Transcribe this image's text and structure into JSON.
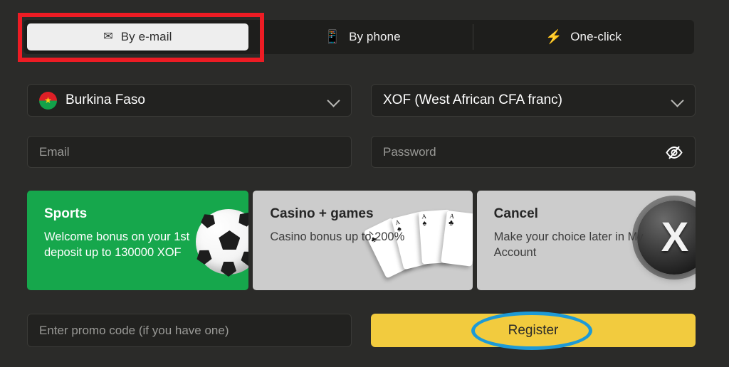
{
  "tabs": [
    {
      "label": "By e-mail",
      "icon": "envelope-icon",
      "glyph": "✉",
      "active": true
    },
    {
      "label": "By phone",
      "icon": "mobile-phone-icon",
      "glyph": "📱",
      "active": false
    },
    {
      "label": "One-click",
      "icon": "lightning-bolt-icon",
      "glyph": "⚡",
      "active": false
    }
  ],
  "form": {
    "country": {
      "value": "Burkina Faso",
      "flag": "burkina-faso-flag",
      "star": "★"
    },
    "currency": {
      "value": "XOF (West African CFA franc)"
    },
    "email": {
      "placeholder": "Email",
      "value": ""
    },
    "password": {
      "placeholder": "Password",
      "value": "",
      "toggle_icon": "eye-slash-icon"
    },
    "promo": {
      "placeholder": "Enter promo code (if you have one)",
      "value": ""
    },
    "register_label": "Register"
  },
  "bonus_cards": [
    {
      "title": "Sports",
      "description": "Welcome bonus on your 1st deposit up to 130000 XOF",
      "art": "soccer-ball-icon",
      "color": "#16a74c"
    },
    {
      "title": "Casino + games",
      "description": "Casino bonus up to 200%",
      "art": "playing-cards-icon",
      "color": "#cccccc"
    },
    {
      "title": "Cancel",
      "description": "Make your choice later in My Account",
      "art": "x-button-icon",
      "color": "#cccccc"
    }
  ],
  "annotations": {
    "tab_highlight_color": "#ed1c24",
    "register_highlight_color": "#1d9ad6"
  },
  "theme": {
    "background": "#2b2b29",
    "panel": "#1e1e1c",
    "field": "#222220",
    "accent_yellow": "#f2cb3e",
    "accent_green": "#16a74c"
  },
  "ace_pips": [
    {
      "rank": "A",
      "suit": "♣"
    },
    {
      "rank": "A",
      "suit": "♠"
    },
    {
      "rank": "A",
      "suit": "♠"
    },
    {
      "rank": "A",
      "suit": "♣"
    }
  ]
}
